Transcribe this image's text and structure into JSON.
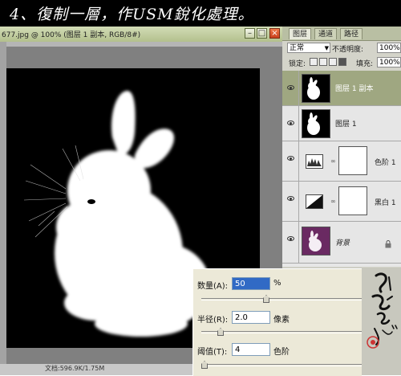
{
  "banner": {
    "text": "4、復制一層，作USM銳化處理。"
  },
  "document": {
    "title": "677.jpg @ 100% (图层 1 副本, RGB/8#)",
    "status": "文档:596.9K/1.75M"
  },
  "layers_panel": {
    "tabs": [
      "图层",
      "通道",
      "路径"
    ],
    "blend_mode": "正常",
    "opacity_label": "不透明度:",
    "opacity_value": "100%",
    "lock_label": "锁定:",
    "fill_label": "填充:",
    "fill_value": "100%",
    "layers": [
      {
        "name": "图层 1 副本",
        "selected": true
      },
      {
        "name": "图层 1"
      },
      {
        "name": "色阶 1"
      },
      {
        "name": "黑白 1"
      },
      {
        "name": "背景"
      }
    ]
  },
  "usm": {
    "amount_label": "数量(A):",
    "amount_value": "50",
    "amount_unit": "%",
    "radius_label": "半径(R):",
    "radius_value": "2.0",
    "radius_unit": "像素",
    "threshold_label": "阈值(T):",
    "threshold_value": "4",
    "threshold_unit": "色阶"
  },
  "colors": {
    "panel_selected": "#9fa781",
    "title_bar": "#c3cda0",
    "close_button": "#d85a2a"
  },
  "icons": [
    "visibility-eye-icon",
    "minimize-icon",
    "maximize-icon",
    "close-icon",
    "dropdown-arrow-icon",
    "lock-icon",
    "chain-link-icon",
    "levels-adjustment-icon",
    "black-white-adjustment-icon"
  ]
}
